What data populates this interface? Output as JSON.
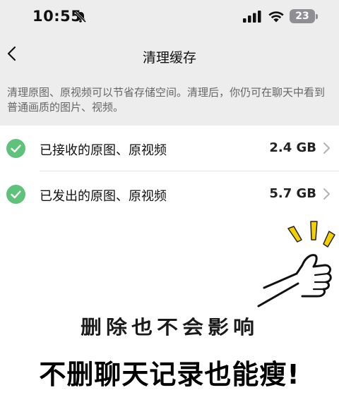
{
  "status_bar": {
    "time": "10:55",
    "battery": "23",
    "icons": [
      "bell-slash-icon",
      "signal-icon",
      "wifi-icon",
      "battery-icon"
    ]
  },
  "nav": {
    "title": "清理缓存",
    "back_icon": "chevron-left-icon"
  },
  "description": "清理原图、原视频可以节省存储空间。清理后，你仍可在聊天中看到普通画质的图片、视频。",
  "items": [
    {
      "label": "已接收的原图、原视频",
      "size": "2.4 GB",
      "checked": true
    },
    {
      "label": "已发出的原图、原视频",
      "size": "5.7 GB",
      "checked": true
    }
  ],
  "overlay": {
    "stylized_text": "删除也不会影响",
    "caption": "不删聊天记录也能瘦!"
  },
  "colors": {
    "check_green": "#5fc27a",
    "background": "#ededed",
    "burst_yellow": "#f5d000"
  }
}
